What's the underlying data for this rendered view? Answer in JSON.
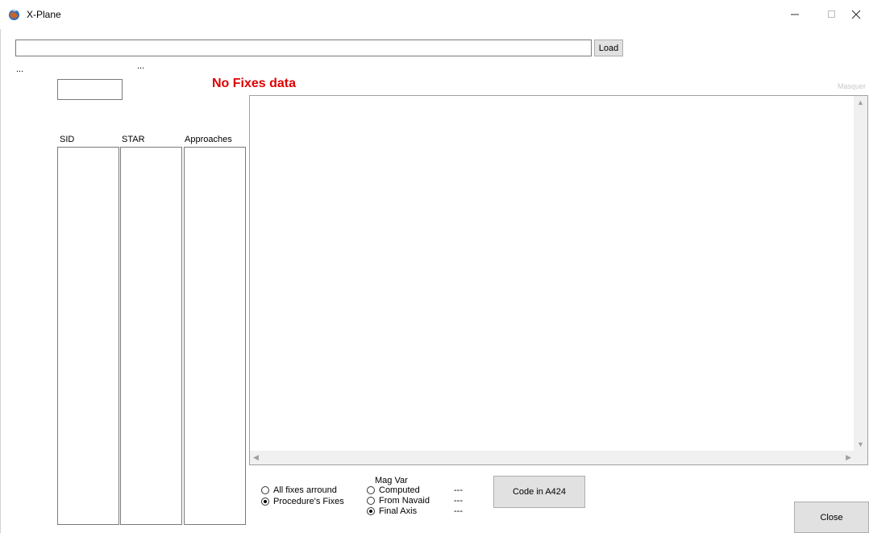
{
  "window": {
    "title": "X-Plane",
    "minimize_icon": "minimize-icon",
    "maximize_icon": "maximize-icon",
    "close_icon": "close-x-icon"
  },
  "file": {
    "path_value": "",
    "load_label": "Load"
  },
  "dots_left": "...",
  "dots_mid": "...",
  "status": {
    "no_fixes": "No Fixes data",
    "masquer": "Masquer"
  },
  "lists": {
    "sid": "SID",
    "star": "STAR",
    "approaches": "Approaches"
  },
  "fixes_mode": {
    "options": [
      {
        "label": "All fixes arround",
        "selected": false
      },
      {
        "label": "Procedure's Fixes",
        "selected": true
      }
    ]
  },
  "magvar": {
    "title": "Mag Var",
    "options": [
      {
        "label": "Computed",
        "value": "---",
        "selected": false
      },
      {
        "label": "From Navaid",
        "value": "---",
        "selected": false
      },
      {
        "label": "Final Axis",
        "value": "---",
        "selected": true
      }
    ]
  },
  "code_button": "Code in A424",
  "close_button": "Close"
}
